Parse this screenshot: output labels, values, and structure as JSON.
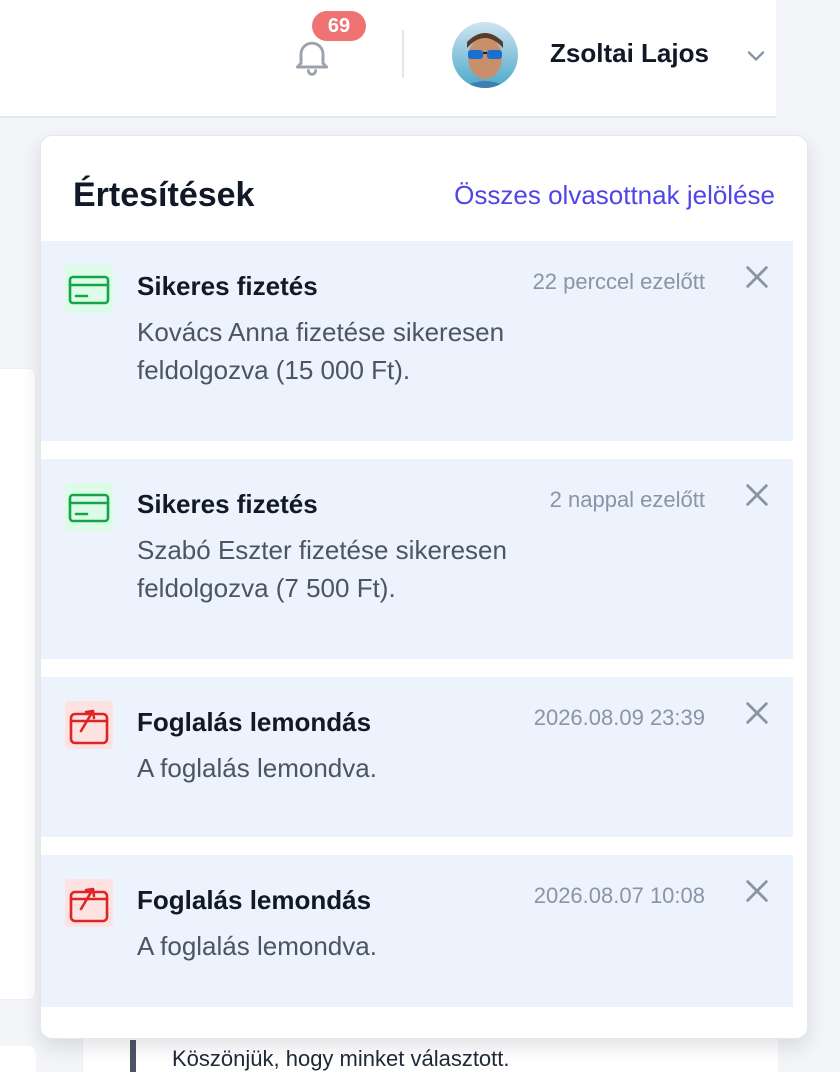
{
  "header": {
    "notification_count": "69",
    "user_name": "Zsoltai Lajos"
  },
  "panel": {
    "title": "Értesítések",
    "mark_all_read": "Összes olvasottnak jelölése",
    "notifications": [
      {
        "type": "payment",
        "icon": "credit-card-icon",
        "title": "Sikeres fizetés",
        "time": "22 perccel ezelőtt",
        "body": "Kovács Anna fizetése sikeresen feldolgozva (15 000 Ft)."
      },
      {
        "type": "payment",
        "icon": "credit-card-icon",
        "title": "Sikeres fizetés",
        "time": "2 nappal ezelőtt",
        "body": "Szabó Eszter fizetése sikeresen feldolgozva (7 500 Ft)."
      },
      {
        "type": "cancellation",
        "icon": "calendar-cancel-icon",
        "title": "Foglalás lemondás",
        "time": "2026.08.09 23:39",
        "body": "A foglalás lemondva."
      },
      {
        "type": "cancellation",
        "icon": "calendar-cancel-icon",
        "title": "Foglalás lemondás",
        "time": "2026.08.07 10:08",
        "body": "A foglalás lemondva."
      }
    ]
  },
  "background": {
    "partial_text": "Köszönjük, hogy minket választott."
  },
  "colors": {
    "accent": "#4f46e5",
    "badge": "#f07373",
    "notification_bg": "#edf3fd",
    "success": "#16a34a",
    "danger": "#dc2626"
  }
}
